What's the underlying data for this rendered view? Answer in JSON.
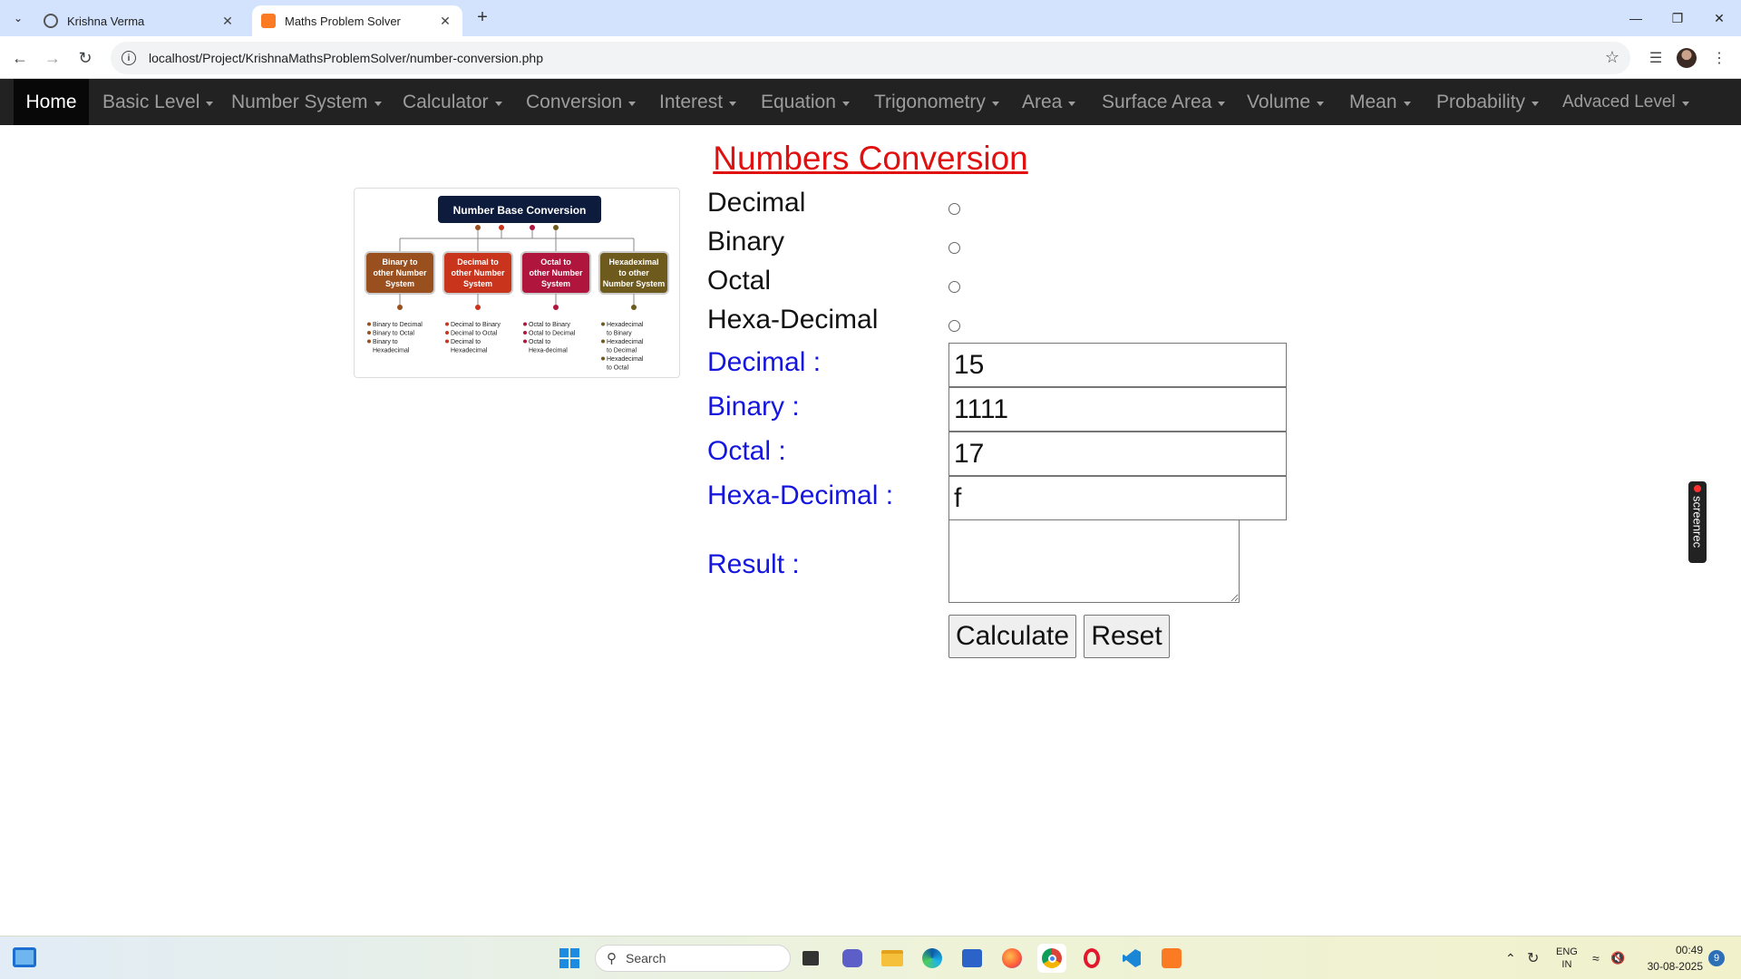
{
  "browser": {
    "tabs": [
      {
        "title": "Krishna Verma",
        "active": false
      },
      {
        "title": "Maths Problem Solver",
        "active": true
      }
    ],
    "url": "localhost/Project/KrishnaMathsProblemSolver/number-conversion.php"
  },
  "navbar": {
    "home": "Home",
    "items": [
      {
        "label": "Basic Level"
      },
      {
        "label": "Number System"
      },
      {
        "label": "Calculator"
      },
      {
        "label": "Conversion"
      },
      {
        "label": "Interest"
      },
      {
        "label": "Equation"
      },
      {
        "label": "Trigonometry"
      },
      {
        "label": "Area"
      },
      {
        "label": "Surface Area"
      },
      {
        "label": "Volume"
      },
      {
        "label": "Mean"
      },
      {
        "label": "Probability"
      },
      {
        "label": "Advaced Level"
      }
    ]
  },
  "page": {
    "title": "Numbers Conversion",
    "diagram": {
      "title": "Number Base Conversion",
      "boxes": [
        {
          "label_lines": [
            "Binary to",
            "other Number",
            "System"
          ],
          "color": "#9a4f1f",
          "items": [
            "Binary to Decimal",
            "Binary to Octal",
            "Binary to",
            "Hexadecimal"
          ]
        },
        {
          "label_lines": [
            "Decimal to",
            "other Number",
            "System"
          ],
          "color": "#c9341d",
          "items": [
            "Decimal to Binary",
            "Decimal to Octal",
            "Decimal to",
            "Hexadecimal"
          ]
        },
        {
          "label_lines": [
            "Octal to",
            "other Number",
            "System"
          ],
          "color": "#b0163d",
          "items": [
            "Octal to Binary",
            "Octal to Decimal",
            "Octal to",
            "Hexa-decimal"
          ]
        },
        {
          "label_lines": [
            "Hexadeximal",
            "to other",
            "Number System"
          ],
          "color": "#6e5a1d",
          "items": [
            "Hexadecimal",
            "to Binary",
            "Hexadecimal",
            "to Decimal",
            "Hexadecimal",
            "to Octal"
          ]
        }
      ]
    },
    "radio_options": [
      {
        "label": "Decimal"
      },
      {
        "label": "Binary"
      },
      {
        "label": "Octal"
      },
      {
        "label": "Hexa-Decimal"
      }
    ],
    "fields": [
      {
        "label": "Decimal :",
        "value": "15"
      },
      {
        "label": "Binary :",
        "value": "1111"
      },
      {
        "label": "Octal :",
        "value": "17"
      },
      {
        "label": "Hexa-Decimal :",
        "value": "f"
      }
    ],
    "result_label": "Result :",
    "calculate_label": "Calculate",
    "reset_label": "Reset"
  },
  "overlay": {
    "screenrec": "screenrec"
  },
  "taskbar": {
    "search_placeholder": "Search",
    "lang_line1": "ENG",
    "lang_line2": "IN",
    "time": "00:49",
    "date": "30-08-2025",
    "notification_count": "9"
  },
  "colors": {
    "title": "#e01010",
    "field_label": "#1515e0",
    "navbar_bg": "#222222",
    "navbar_active_bg": "#080808"
  }
}
